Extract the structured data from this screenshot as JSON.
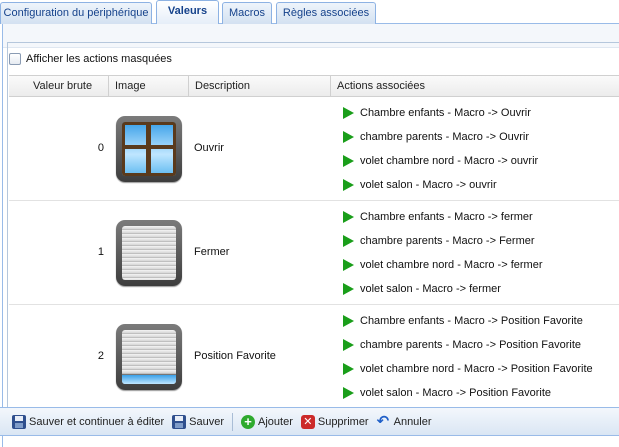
{
  "tabs": [
    {
      "label": "Configuration du périphérique"
    },
    {
      "label": "Valeurs"
    },
    {
      "label": "Macros"
    },
    {
      "label": "Règles associées"
    }
  ],
  "show_hidden_label": "Afficher les actions masquées",
  "columns": {
    "raw_value": "Valeur brute",
    "image": "Image",
    "description": "Description",
    "actions": "Actions associées"
  },
  "rows": [
    {
      "value": "0",
      "image": "window-open-icon",
      "description": "Ouvrir",
      "actions": [
        "Chambre enfants - Macro -> Ouvrir",
        "chambre parents - Macro -> Ouvrir",
        "volet chambre nord - Macro -> ouvrir",
        "volet salon - Macro -> ouvrir"
      ]
    },
    {
      "value": "1",
      "image": "shutter-closed-icon",
      "description": "Fermer",
      "actions": [
        "Chambre enfants - Macro -> fermer",
        "chambre parents - Macro -> Fermer",
        "volet chambre nord - Macro -> fermer",
        "volet salon - Macro -> fermer"
      ]
    },
    {
      "value": "2",
      "image": "shutter-partial-icon",
      "description": "Position Favorite",
      "actions": [
        "Chambre enfants - Macro -> Position Favorite",
        "chambre parents - Macro -> Position Favorite",
        "volet chambre nord - Macro -> Position Favorite",
        "volet salon - Macro -> Position Favorite"
      ]
    }
  ],
  "toolbar": {
    "save_continue": "Sauver et continuer à éditer",
    "save": "Sauver",
    "add": "Ajouter",
    "delete": "Supprimer",
    "cancel": "Annuler"
  },
  "colors": {
    "tab_text": "#15428b",
    "play_icon": "#1a9e1a",
    "border_blue": "#99bbe8"
  }
}
